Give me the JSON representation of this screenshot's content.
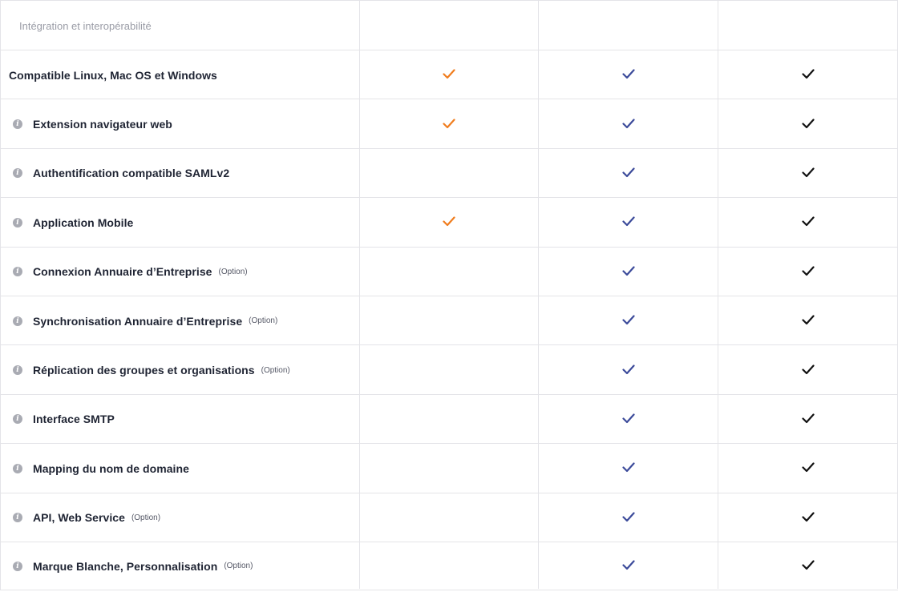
{
  "section": {
    "title": "Intégration et interopérabilité"
  },
  "colors": {
    "orange_check": "#f07d1e",
    "blue_check": "#3b4a9a",
    "black_check": "#111111"
  },
  "rows": [
    {
      "label": "Compatible Linux, Mac OS et Windows",
      "info": false,
      "option": "",
      "checks": [
        "orange",
        "blue",
        "black"
      ]
    },
    {
      "label": "Extension navigateur web",
      "info": true,
      "option": "",
      "checks": [
        "orange",
        "blue",
        "black"
      ]
    },
    {
      "label": "Authentification compatible SAMLv2",
      "info": true,
      "option": "",
      "checks": [
        "",
        "blue",
        "black"
      ]
    },
    {
      "label": "Application Mobile",
      "info": true,
      "option": "",
      "checks": [
        "orange",
        "blue",
        "black"
      ]
    },
    {
      "label": "Connexion Annuaire d’Entreprise",
      "info": true,
      "option": "(Option)",
      "checks": [
        "",
        "blue",
        "black"
      ]
    },
    {
      "label": "Synchronisation Annuaire d’Entreprise",
      "info": true,
      "option": "(Option)",
      "checks": [
        "",
        "blue",
        "black"
      ]
    },
    {
      "label": "Réplication des groupes et organisations",
      "info": true,
      "option": "(Option)",
      "checks": [
        "",
        "blue",
        "black"
      ]
    },
    {
      "label": "Interface SMTP",
      "info": true,
      "option": "",
      "checks": [
        "",
        "blue",
        "black"
      ]
    },
    {
      "label": "Mapping du nom de domaine",
      "info": true,
      "option": "",
      "checks": [
        "",
        "blue",
        "black"
      ]
    },
    {
      "label": "API, Web Service",
      "info": true,
      "option": "(Option)",
      "checks": [
        "",
        "blue",
        "black"
      ]
    },
    {
      "label": "Marque Blanche, Personnalisation",
      "info": true,
      "option": "(Option)",
      "checks": [
        "",
        "blue",
        "black"
      ]
    }
  ]
}
